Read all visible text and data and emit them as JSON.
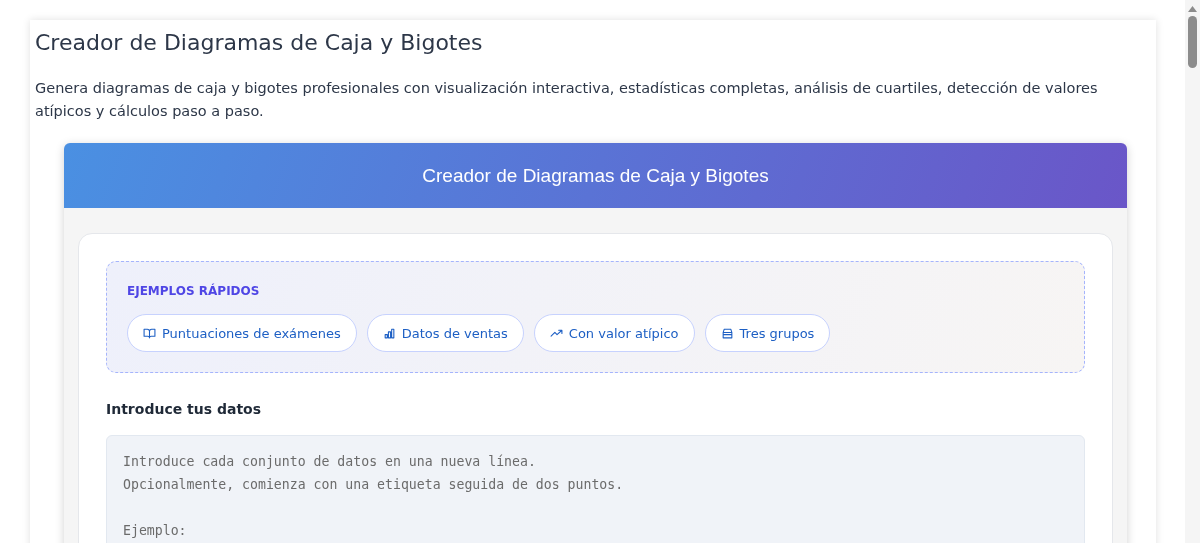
{
  "page": {
    "title": "Creador de Diagramas de Caja y Bigotes",
    "description": "Genera diagramas de caja y bigotes profesionales con visualización interactiva, estadísticas completas, análisis de cuartiles, detección de valores atípicos y cálculos paso a paso."
  },
  "widget": {
    "header": "Creador de Diagramas de Caja y Bigotes",
    "examples": {
      "heading": "EJEMPLOS RÁPIDOS",
      "buttons": [
        {
          "kind": "book",
          "label": "Puntuaciones de exámenes"
        },
        {
          "kind": "bars",
          "label": "Datos de ventas"
        },
        {
          "kind": "trend",
          "label": "Con valor atípico"
        },
        {
          "kind": "stack",
          "label": "Tres grupos"
        }
      ]
    },
    "input": {
      "label": "Introduce tus datos",
      "placeholder": "Introduce cada conjunto de datos en una nueva línea.\nOpcionalmente, comienza con una etiqueta seguida de dos puntos.\n\nEjemplo:"
    }
  }
}
